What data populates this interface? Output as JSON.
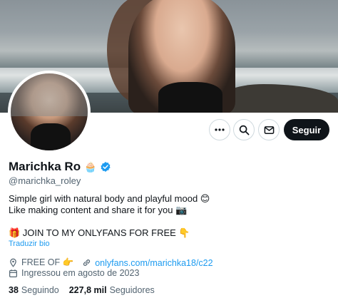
{
  "profile": {
    "display_name": "Marichka Ro",
    "name_emoji": "🧁",
    "handle": "@marichka_roley",
    "bio_line1": "Simple girl with natural body and playful mood 😊",
    "bio_line2": "Like making content and share it for you 📷",
    "bio_line3": "🎁 JOIN TO MY ONLYFANS FOR FREE 👇",
    "translate_label": "Traduzir bio",
    "location": "FREE OF 👉",
    "website": "onlyfans.com/marichka18/c22",
    "joined": "Ingressou em agosto de 2023",
    "following_count": "38",
    "following_label": "Seguindo",
    "followers_count": "227,8 mil",
    "followers_label": "Seguidores"
  },
  "actions": {
    "more_icon": "more-icon",
    "search_icon": "search-icon",
    "message_icon": "mail-icon",
    "follow_label": "Seguir"
  },
  "colors": {
    "accent": "#1d9bf0",
    "text": "#0f1419",
    "muted": "#536471",
    "button_dark": "#0f1419"
  }
}
